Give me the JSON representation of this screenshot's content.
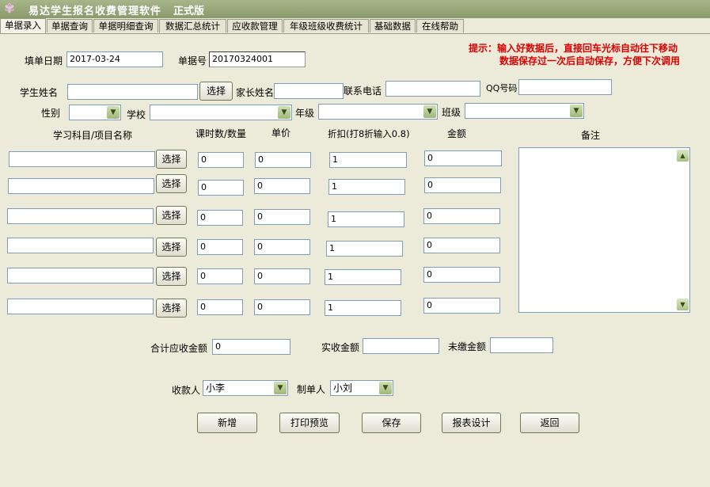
{
  "titlebar": {
    "title": "易达学生报名收费管理软件",
    "edition": "正式版"
  },
  "tabs": [
    {
      "label": "单据录入"
    },
    {
      "label": "单据查询"
    },
    {
      "label": "单据明细查询"
    },
    {
      "label": "数据汇总统计"
    },
    {
      "label": "应收款管理"
    },
    {
      "label": "年级班级收费统计"
    },
    {
      "label": "基础数据"
    },
    {
      "label": "在线帮助"
    }
  ],
  "tips": {
    "line1": "提示：输入好数据后，直接回车光标自动往下移动",
    "line2": "数据保存过一次后自动保存，方便下次调用"
  },
  "form": {
    "date_label": "填单日期",
    "date_value": "2017-03-24",
    "doc_no_label": "单据号",
    "doc_no_value": "20170324001",
    "student_label": "学生姓名",
    "select_label": "选择",
    "parent_label": "家长姓名",
    "phone_label": "联系电话",
    "qq_label": "QQ号码",
    "gender_label": "性别",
    "school_label": "学校",
    "grade_label": "年级",
    "class_label": "班级"
  },
  "table": {
    "headers": {
      "subject": "学习科目/项目名称",
      "hours": "课时数/数量",
      "price": "单价",
      "discount": "折扣(打8折输入0.8)",
      "amount": "金额",
      "remark": "备注"
    },
    "rows": [
      {
        "hours": "0",
        "price": "0",
        "discount": "1",
        "amount": "0"
      },
      {
        "hours": "0",
        "price": "0",
        "discount": "1",
        "amount": "0"
      },
      {
        "hours": "0",
        "price": "0",
        "discount": "1",
        "amount": "0"
      },
      {
        "hours": "0",
        "price": "0",
        "discount": "1",
        "amount": "0"
      },
      {
        "hours": "0",
        "price": "0",
        "discount": "1",
        "amount": "0"
      },
      {
        "hours": "0",
        "price": "0",
        "discount": "1",
        "amount": "0"
      }
    ]
  },
  "totals": {
    "due_label": "合计应收金额",
    "due_value": "0",
    "received_label": "实收金额",
    "unpaid_label": "未缴金额"
  },
  "people": {
    "payee_label": "收款人",
    "payee_value": "小李",
    "maker_label": "制单人",
    "maker_value": "小刘"
  },
  "actions": {
    "new": "新增",
    "print_preview": "打印预览",
    "save": "保存",
    "report_design": "报表设计",
    "back": "返回"
  },
  "icons": {
    "app": "app-flower-icon",
    "dropdown": "chevron-down-icon",
    "scroll_up": "scroll-up-icon",
    "scroll_down": "scroll-down-icon"
  }
}
